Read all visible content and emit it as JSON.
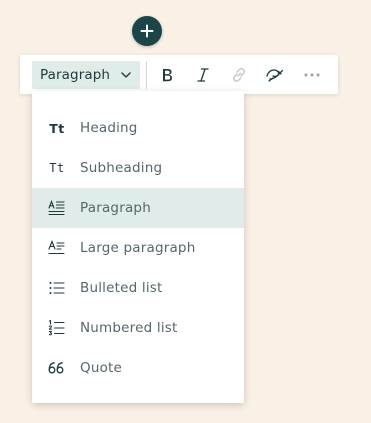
{
  "add_button": {
    "icon": "plus-icon",
    "color": "#1c4548"
  },
  "toolbar": {
    "style_select": {
      "selected": "Paragraph",
      "icon": "chevron-down-icon"
    },
    "buttons": [
      {
        "name": "bold",
        "icon": "bold-icon"
      },
      {
        "name": "italic",
        "icon": "italic-icon"
      },
      {
        "name": "link",
        "icon": "link-icon",
        "disabled": true
      },
      {
        "name": "highlight",
        "icon": "highlight-icon"
      },
      {
        "name": "more",
        "icon": "more-icon"
      }
    ]
  },
  "menu": {
    "items": [
      {
        "label": "Heading",
        "icon_text": "Tt",
        "icon": "heading-icon"
      },
      {
        "label": "Subheading",
        "icon_text": "Tt",
        "icon": "subheading-icon"
      },
      {
        "label": "Paragraph",
        "icon": "paragraph-icon",
        "selected": true
      },
      {
        "label": "Large paragraph",
        "icon": "large-paragraph-icon"
      },
      {
        "label": "Bulleted list",
        "icon": "bulleted-list-icon"
      },
      {
        "label": "Numbered list",
        "icon": "numbered-list-icon"
      },
      {
        "label": "Quote",
        "icon": "quote-icon"
      }
    ]
  },
  "colors": {
    "background": "#f9f0e6",
    "accent_dark": "#1c4548",
    "selected_bg": "#dfecea",
    "text": "#55676a"
  }
}
